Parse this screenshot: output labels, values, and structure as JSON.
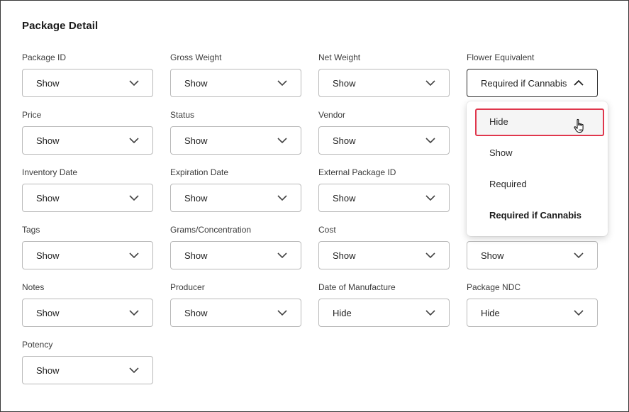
{
  "title": "Package Detail",
  "fields": [
    {
      "label": "Package ID",
      "value": "Show"
    },
    {
      "label": "Gross Weight",
      "value": "Show"
    },
    {
      "label": "Net Weight",
      "value": "Show"
    },
    {
      "label": "Flower Equivalent",
      "value": "Required if Cannabis",
      "open": true
    },
    {
      "label": "Price",
      "value": "Show"
    },
    {
      "label": "Status",
      "value": "Show"
    },
    {
      "label": "Vendor",
      "value": "Show"
    },
    {
      "label": "",
      "value": ""
    },
    {
      "label": "Inventory Date",
      "value": "Show"
    },
    {
      "label": "Expiration Date",
      "value": "Show"
    },
    {
      "label": "External Package ID",
      "value": "Show"
    },
    {
      "label": "",
      "value": ""
    },
    {
      "label": "Tags",
      "value": "Show"
    },
    {
      "label": "Grams/Concentration",
      "value": "Show"
    },
    {
      "label": "Cost",
      "value": "Show"
    },
    {
      "label": "",
      "value": "Show"
    },
    {
      "label": "Notes",
      "value": "Show"
    },
    {
      "label": "Producer",
      "value": "Show"
    },
    {
      "label": "Date of Manufacture",
      "value": "Hide"
    },
    {
      "label": "Package NDC",
      "value": "Hide"
    },
    {
      "label": "Potency",
      "value": "Show"
    }
  ],
  "dropdown": {
    "options": [
      "Hide",
      "Show",
      "Required",
      "Required if Cannabis"
    ],
    "hovered": "Hide",
    "selected": "Required if Cannabis"
  },
  "colors": {
    "highlight_border": "#e0364c",
    "open_border": "#2a2a2a"
  }
}
